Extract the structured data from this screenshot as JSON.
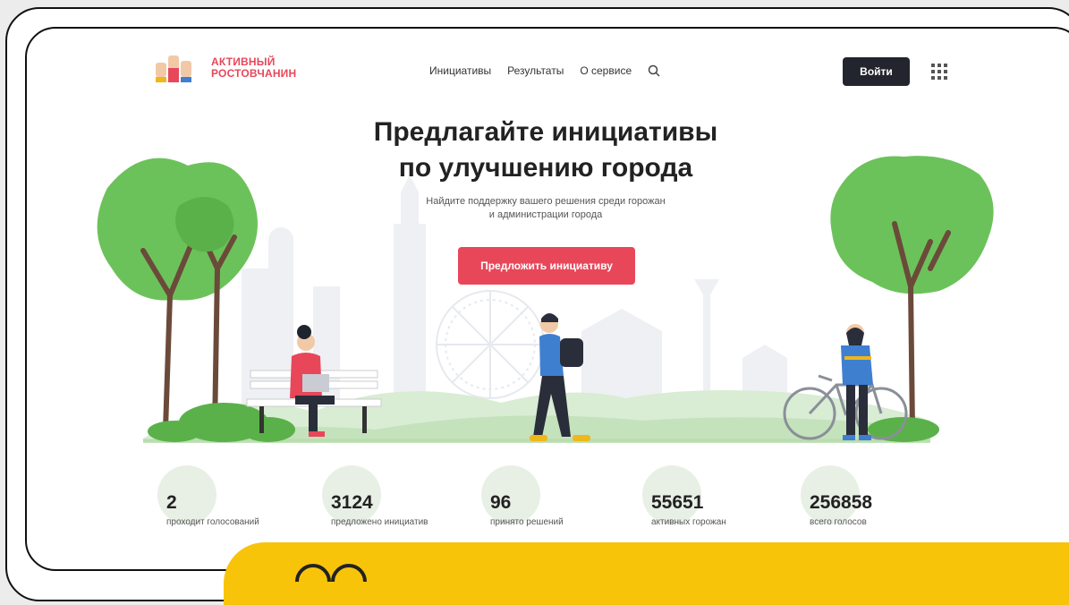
{
  "header": {
    "logo_line1": "АКТИВНЫЙ",
    "logo_line2": "РОСТОВЧАНИН",
    "nav": [
      "Инициативы",
      "Результаты",
      "О сервисе"
    ],
    "login_label": "Войти"
  },
  "hero": {
    "title_line1": "Предлагайте инициативы",
    "title_line2": "по улучшению города",
    "subtitle_line1": "Найдите поддержку вашего решения среди горожан",
    "subtitle_line2": "и администрации города",
    "cta_label": "Предложить инициативу"
  },
  "stats": [
    {
      "value": "2",
      "label": "проходит голосований"
    },
    {
      "value": "3124",
      "label": "предложено инициатив"
    },
    {
      "value": "96",
      "label": "принято решений"
    },
    {
      "value": "55651",
      "label": "активных горожан"
    },
    {
      "value": "256858",
      "label": "всего голосов"
    }
  ],
  "colors": {
    "accent": "#e8475a",
    "dark": "#23252e",
    "green": "#6cc25a",
    "yellow": "#f8c40a"
  }
}
